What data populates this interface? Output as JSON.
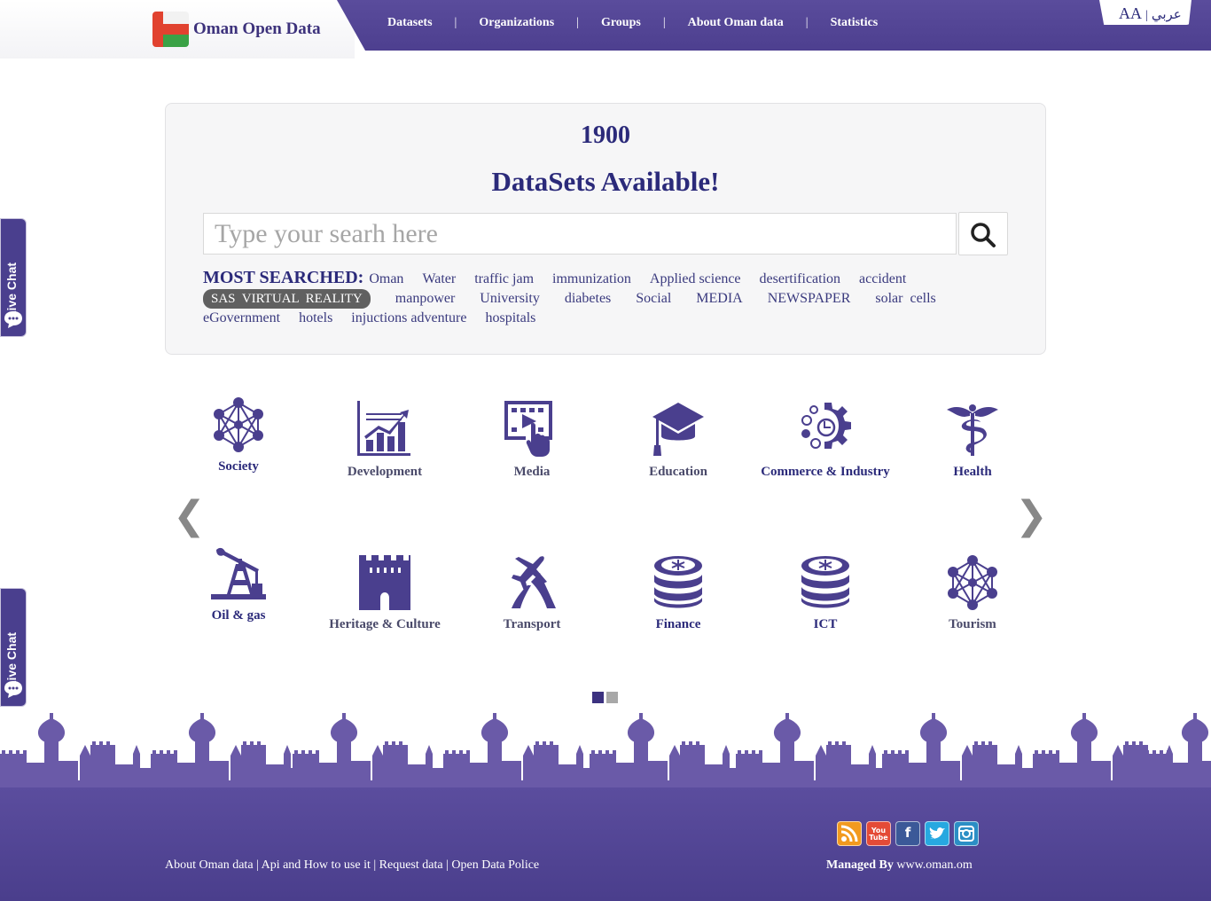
{
  "header": {
    "site_name": "Oman Open Data",
    "nav": [
      "Datasets",
      "Organizations",
      "Groups",
      "About Oman data",
      "Statistics"
    ],
    "lang_aa": "AA",
    "lang_sep": "|",
    "lang_ar": "عربي"
  },
  "hero": {
    "count": "1900",
    "tagline": "DataSets Available!",
    "search_placeholder": "Type your searh here",
    "most_searched_label": "MOST SEARCHED:",
    "tags": [
      "Oman",
      "Water",
      "traffic jam",
      "immunization",
      "Applied science",
      "desertification",
      "accident",
      "SAS  VIRTUAL  REALITY",
      "manpower",
      "University",
      "diabetes",
      "Social",
      "MEDIA",
      "NEWSPAPER",
      "solar  cells",
      "eGovernment",
      "hotels",
      "injuctions adventure",
      "hospitals"
    ],
    "highlighted_tag": "SAS  VIRTUAL  REALITY"
  },
  "categories": {
    "row1": [
      {
        "label": "Society",
        "icon": "network-icon"
      },
      {
        "label": "Development",
        "icon": "bar-chart-icon"
      },
      {
        "label": "Media",
        "icon": "video-icon"
      },
      {
        "label": "Education",
        "icon": "graduation-cap-icon"
      },
      {
        "label": "Commerce & Industry",
        "icon": "gear-icon"
      },
      {
        "label": "Health",
        "icon": "caduceus-icon"
      }
    ],
    "row2": [
      {
        "label": "Oil & gas",
        "icon": "oil-pump-icon"
      },
      {
        "label": "Heritage & Culture",
        "icon": "fort-icon"
      },
      {
        "label": "Transport",
        "icon": "plane-road-icon"
      },
      {
        "label": "Finance",
        "icon": "coins-icon"
      },
      {
        "label": "ICT",
        "icon": "coins-icon"
      },
      {
        "label": "Tourism",
        "icon": "network-icon"
      }
    ],
    "prev": "❮",
    "next": "❯",
    "pager": {
      "pages": 2,
      "current": 1
    }
  },
  "live_chat": {
    "label": "Live Chat"
  },
  "footer": {
    "links": [
      "About Oman data",
      "Api and How to use it",
      "Request data",
      "Open Data Police"
    ],
    "link_sep": "|",
    "managed_by_label": "Managed By",
    "managed_by_value": "www.oman.om",
    "social": [
      "rss-icon",
      "youtube-icon",
      "facebook-icon",
      "twitter-icon",
      "instagram-icon"
    ],
    "youtube_text": "You Tube",
    "facebook_text": "f"
  },
  "colors": {
    "brand": "#4d3f8f",
    "text": "#2b2a7a"
  }
}
